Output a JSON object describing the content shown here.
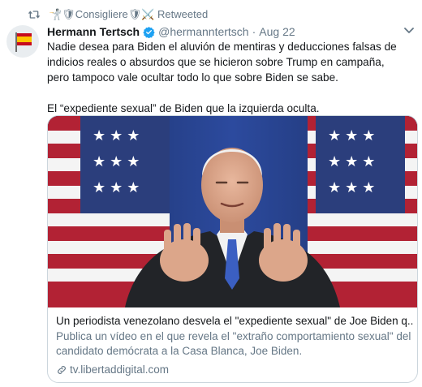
{
  "retweet": {
    "retweeter_name": "🤺🛡Consigliere🛡⚔️",
    "label": " Retweeted"
  },
  "tweet": {
    "author_name": "Hermann Tertsch",
    "handle": "@hermanntertsch",
    "separator": "·",
    "date": "Aug 22",
    "paragraph_1": "Nadie desea para Biden el aluvión de mentiras y deducciones falsas de indicios reales o absurdos que se hicieron sobre Trump en campaña, pero tampoco vale ocultar todo lo que sobre Biden se sabe.",
    "paragraph_2": "El “expediente sexual” de Biden que la izquierda oculta."
  },
  "card": {
    "title": "Un periodista venezolano desvela el \"expediente sexual\" de Joe Biden q...",
    "description": "Publica un vídeo en el que revela el \"extraño comportamiento sexual\" del candidato demócrata a la Casa Blanca, Joe Biden.",
    "domain": "tv.libertaddigital.com"
  },
  "icons": {
    "retweet": "retweet-icon",
    "verified": "verified-badge-icon",
    "caret": "chevron-down-icon",
    "link": "link-icon",
    "avatar_flag": "spain-flag"
  },
  "colors": {
    "secondary_text": "#657786",
    "verified_blue": "#1da1f2",
    "card_border": "#ccd6dd"
  }
}
